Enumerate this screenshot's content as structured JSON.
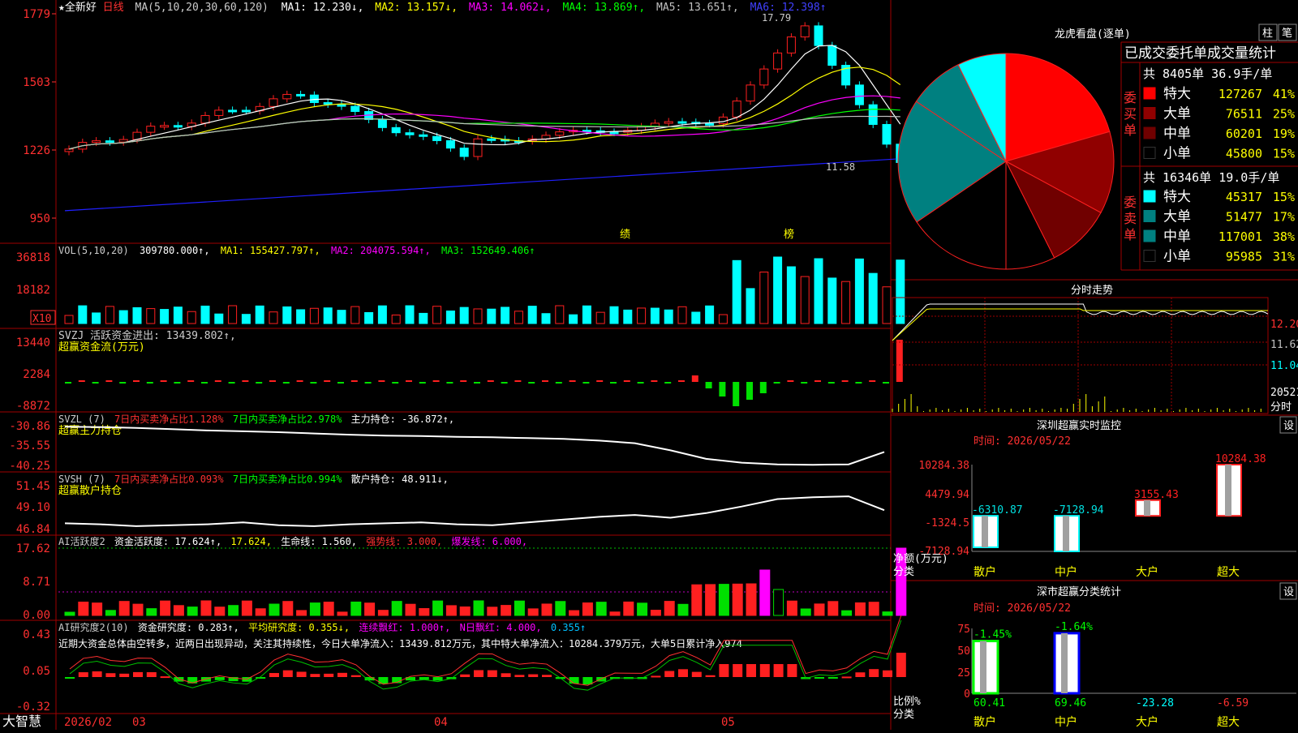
{
  "app": {
    "name": "大智慧"
  },
  "header": {
    "stock_name": "★全新好",
    "period": "日线",
    "ma_label": "MA(5,10,20,30,60,120)",
    "ma1": "MA1: 12.230↓,",
    "ma2": "MA2: 13.157↓,",
    "ma3": "MA3: 14.062↓,",
    "ma4": "MA4: 13.869↑,",
    "ma5": "MA5: 13.651↑,",
    "ma6": "MA6: 12.398↑"
  },
  "colors": {
    "up": "#ff2020",
    "down": "#00ffff",
    "grid": "#a00000",
    "axis_text": "#ff3030",
    "ma1": "#ffffff",
    "ma2": "#ffff00",
    "ma3": "#ff00ff",
    "ma4": "#00ff00",
    "ma5": "#c0c0c0",
    "ma6": "#2020ff"
  },
  "price_panel": {
    "y_ticks": [
      "1779",
      "1503",
      "1226",
      "950"
    ],
    "high_mark": "17.79",
    "low_mark": "11.58",
    "event_marks": [
      "绩",
      "榜"
    ]
  },
  "vol_panel": {
    "title": "VOL(5,10,20)",
    "value": "309780.000↑,",
    "ma1": "MA1: 155427.797↑,",
    "ma2": "MA2: 204075.594↑,",
    "ma3": "MA3: 152649.406↑",
    "y_ticks": [
      "36818",
      "18182"
    ],
    "unit": "X10"
  },
  "svzj_panel": {
    "title": "SVZJ  活跃资金进出: 13439.802↑,",
    "subtitle": "超赢资金流(万元)",
    "y_ticks": [
      "13440",
      "2284",
      "-8872"
    ]
  },
  "svzl_panel": {
    "title": "SVZL (7)",
    "part1": "7日内买卖净占比1.128%",
    "part2": "7日内买卖净占比2.978%",
    "part3": "主力持仓: -36.872↑,",
    "subtitle": "超赢主力持仓",
    "y_ticks": [
      "-30.86",
      "-35.55",
      "-40.25"
    ]
  },
  "svsh_panel": {
    "title": "SVSH (7)",
    "part1": "7日内买卖净占比0.093%",
    "part2": "7日内买卖净占比0.994%",
    "part3": "散户持仓: 48.911↓,",
    "subtitle": "超赢散户持仓",
    "y_ticks": [
      "51.45",
      "49.10",
      "46.84"
    ]
  },
  "ai_panel": {
    "title": "AI活跃度2",
    "part1": "资金活跃度: 17.624↑,",
    "part2": "17.624,",
    "part3": "生命线: 1.560,",
    "part4": "强势线: 3.000,",
    "part5": "爆发线: 6.000,",
    "y_ticks": [
      "17.62",
      "8.71",
      "0.00"
    ]
  },
  "research_panel": {
    "title": "AI研究度2(10)",
    "part1": "资金研究度: 0.283↑,",
    "part2": "平均研究度: 0.355↓,",
    "part3": "连续飘红: 1.000↑,",
    "part4": "N日飘红: 4.000,",
    "part5": "0.355↑",
    "comment": "近期大资金总体由空转多，近两日出现异动，关注其持续性，今日大单净流入：13439.812万元，其中特大单净流入：10284.379万元，大单5日累计净入974",
    "y_ticks": [
      "0.43",
      "0.05",
      "-0.32"
    ]
  },
  "x_axis": {
    "labels": [
      "2026/02",
      "03",
      "04",
      "05"
    ]
  },
  "lhb": {
    "title": "龙虎看盘(逐单)",
    "btn1": "柱",
    "btn2": "笔",
    "table_title": "已成交委托单成交量统计",
    "buy_header": "共 8405单 36.9手/单",
    "buy_label": "委买单",
    "sell_header": "共 16346单 19.0手/单",
    "sell_label": "委卖单",
    "buy_rows": [
      {
        "name": "特大",
        "vol": "127267",
        "pct": "41%",
        "color": "#ff0000"
      },
      {
        "name": "大单",
        "vol": "76511",
        "pct": "25%",
        "color": "#900000"
      },
      {
        "name": "中单",
        "vol": "60201",
        "pct": "19%",
        "color": "#700000"
      },
      {
        "name": "小单",
        "vol": "45800",
        "pct": "15%",
        "color": "#000000"
      }
    ],
    "sell_rows": [
      {
        "name": "特大",
        "vol": "45317",
        "pct": "15%",
        "color": "#00ffff"
      },
      {
        "name": "大单",
        "vol": "51477",
        "pct": "17%",
        "color": "#008080"
      },
      {
        "name": "中单",
        "vol": "117001",
        "pct": "38%",
        "color": "#008080"
      },
      {
        "name": "小单",
        "vol": "95985",
        "pct": "31%",
        "color": "#000000"
      }
    ]
  },
  "intraday": {
    "title": "分时走势",
    "y_ticks": [
      "12.20",
      "11.62",
      "11.04"
    ],
    "vol_tick": "20521",
    "unit": "分时"
  },
  "sz_monitor": {
    "title": "深圳超赢实时监控",
    "btn": "设",
    "time": "时间: 2026/05/22",
    "y_ticks": [
      "10284.38",
      "4479.94",
      "-1324.5",
      "-7128.94"
    ],
    "y_unit": "净额(万元)",
    "x_unit": "分类",
    "categories": [
      "散户",
      "中户",
      "大户",
      "超大"
    ],
    "values": [
      -6310.87,
      -7128.94,
      3155.43,
      10284.38
    ],
    "value_labels": [
      "-6310.87",
      "-7128.94",
      "3155.43",
      "10284.38"
    ]
  },
  "sz_class": {
    "title": "深市超赢分类统计",
    "btn": "设",
    "time": "时间: 2026/05/22",
    "y_ticks": [
      "75",
      "50",
      "25",
      "0"
    ],
    "y_unit": "比例%",
    "x_unit": "分类",
    "categories": [
      "散户",
      "中户",
      "大户",
      "超大"
    ],
    "top_labels": [
      "-1.45%",
      "-1.64%"
    ],
    "bottom_labels": [
      "60.41",
      "69.46",
      "-23.28",
      "-6.59"
    ]
  },
  "chart_data": [
    {
      "type": "bar",
      "title": "龙虎看盘(逐单)",
      "categories": [
        "委买特大",
        "委买大单",
        "委买中单",
        "委买小单",
        "委卖小单",
        "委卖中单",
        "委卖大单",
        "委卖特大"
      ],
      "values": [
        127267,
        76511,
        60201,
        45800,
        95985,
        117001,
        51477,
        45317
      ]
    },
    {
      "type": "bar",
      "title": "深圳超赢实时监控",
      "categories": [
        "散户",
        "中户",
        "大户",
        "超大"
      ],
      "values": [
        -6310.87,
        -7128.94,
        3155.43,
        10284.38
      ],
      "ylim": [
        -7128.94,
        10284.38
      ]
    },
    {
      "type": "bar",
      "title": "深市超赢分类统计",
      "categories": [
        "散户",
        "中户",
        "大户",
        "超大"
      ],
      "values": [
        60.41,
        69.46,
        -23.28,
        -6.59
      ],
      "ylim": [
        0,
        75
      ]
    },
    {
      "type": "line",
      "title": "SVZL",
      "ylim": [
        -40.25,
        -30.86
      ],
      "series": [
        {
          "values": [
            -30.9,
            -31.0,
            -31.2,
            -31.5,
            -31.8,
            -32.0,
            -32.2,
            -32.5,
            -32.8,
            -33.0,
            -33.1,
            -33.3,
            -33.4,
            -33.6,
            -33.8,
            -34.2,
            -34.8,
            -36.5,
            -38.5,
            -39.4,
            -39.8,
            -39.9,
            -39.8,
            -36.87
          ]
        }
      ]
    },
    {
      "type": "line",
      "title": "SVSH",
      "ylim": [
        46.84,
        51.45
      ],
      "series": [
        {
          "values": [
            47.5,
            47.4,
            47.2,
            47.3,
            47.4,
            47.6,
            47.3,
            47.2,
            47.4,
            47.5,
            47.6,
            47.4,
            47.3,
            47.6,
            47.9,
            48.2,
            48.4,
            48.1,
            48.6,
            49.3,
            50.1,
            50.3,
            50.4,
            48.91
          ]
        }
      ]
    }
  ]
}
